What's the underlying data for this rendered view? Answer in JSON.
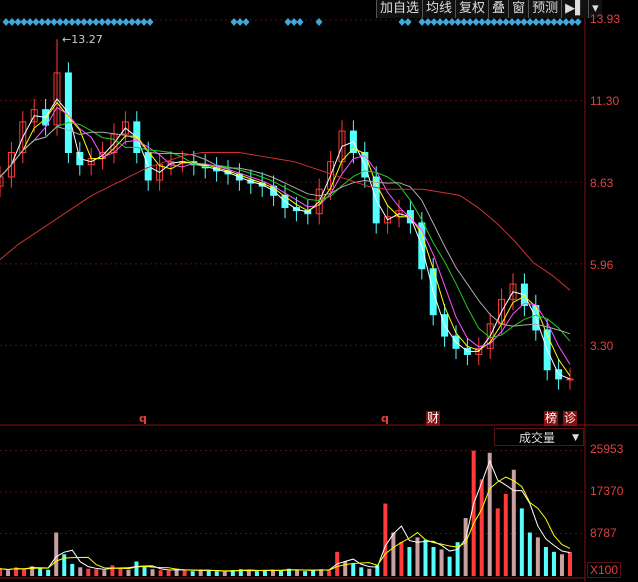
{
  "toolbar": {
    "add_watch": "加自选",
    "ma": "均线",
    "adjust": "复权",
    "overlay": "叠",
    "window": "窗",
    "forecast": "预测",
    "expand": "▶▌",
    "menu": "▾"
  },
  "markers": {
    "q1": "q",
    "q2": "q",
    "cai": "财",
    "bang": "榜",
    "zhen": "诊",
    "high_label": "13.27"
  },
  "volume_panel": {
    "indicator": "成交量",
    "unit": "X100"
  },
  "colors": {
    "up": "#ff3b3b",
    "down": "#54ffff",
    "axis": "#8a1010",
    "ma1": "#ffffff",
    "ma2": "#ffff00",
    "ma3": "#ff55ff",
    "ma4": "#22cc22",
    "ma5": "#aaaaaa",
    "ma_long": "#d03030"
  },
  "chart_data": [
    {
      "type": "line",
      "title": "Price (K-line)",
      "ylim": [
        1.2,
        13.93
      ],
      "y_ticks": [
        "13.93",
        "11.30",
        "8.63",
        "5.96",
        "3.30"
      ],
      "y_tick_values": [
        13.93,
        11.3,
        8.63,
        5.96,
        3.3
      ],
      "max_annotation": 13.27,
      "close": [
        8.8,
        9.6,
        10.6,
        11.0,
        10.5,
        12.2,
        9.6,
        9.2,
        9.4,
        9.6,
        10.2,
        10.6,
        9.6,
        8.7,
        9.2,
        9.3,
        9.3,
        9.2,
        9.1,
        9.0,
        8.9,
        8.7,
        8.6,
        8.5,
        8.2,
        7.8,
        7.7,
        7.6,
        8.4,
        9.3,
        10.3,
        9.6,
        8.8,
        7.3,
        7.5,
        7.7,
        7.3,
        5.8,
        4.3,
        3.6,
        3.2,
        3.0,
        3.2,
        4.0,
        4.8,
        5.3,
        4.6,
        3.8,
        2.5,
        2.2,
        2.2
      ],
      "ma_long": [
        6.1,
        6.6,
        7.0,
        7.4,
        7.8,
        8.2,
        8.5,
        8.8,
        9.1,
        9.3,
        9.5,
        9.6,
        9.6,
        9.6,
        9.5,
        9.4,
        9.3,
        9.1,
        8.9,
        8.7,
        8.5,
        8.4,
        8.4,
        8.4,
        8.3,
        8.2,
        7.8,
        7.3,
        6.7,
        6.0,
        5.6,
        5.1
      ]
    },
    {
      "type": "bar",
      "title": "成交量",
      "ylim": [
        0,
        26500
      ],
      "y_ticks": [
        "25953",
        "17370",
        "8787"
      ],
      "y_tick_values": [
        25953,
        17370,
        8787
      ],
      "values": [
        1500,
        1200,
        1800,
        1400,
        2000,
        1700,
        1300,
        9000,
        4500,
        2500,
        1800,
        1500,
        1400,
        1200,
        2200,
        1600,
        1300,
        3000,
        1900,
        1400,
        1200,
        1100,
        1500,
        1200,
        1000,
        1300,
        1100,
        1000,
        900,
        1200,
        1400,
        1100,
        1000,
        1200,
        1300,
        1100,
        1500,
        1200,
        1000,
        1300,
        1400,
        1100,
        5000,
        3000,
        2500,
        1800,
        1500,
        2200,
        15000,
        9000,
        7000,
        6000,
        8000,
        7500,
        6000,
        5500,
        4000,
        7000,
        12000,
        25953,
        20000,
        25500,
        14000,
        17000,
        22000,
        14000,
        9000,
        8000,
        6000,
        5000,
        4500,
        5000
      ]
    }
  ]
}
